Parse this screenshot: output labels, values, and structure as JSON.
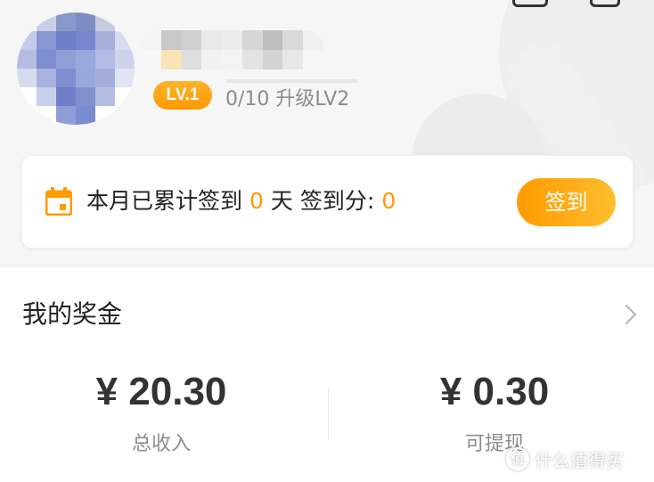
{
  "profile": {
    "level_badge": "LV.1",
    "level_progress_text": "0/10 升级LV2",
    "level_progress_fraction": 0
  },
  "signin": {
    "prefix": "本月已累计签到",
    "days_count": "0",
    "days_unit": "天",
    "score_label": "签到分:",
    "score_value": "0",
    "button_label": "签到"
  },
  "bonus": {
    "title": "我的奖金",
    "total": {
      "amount": "¥ 20.30",
      "label": "总收入"
    },
    "withdrawable": {
      "amount": "¥ 0.30",
      "label": "可提现"
    }
  },
  "watermark": {
    "logo": "值",
    "text": "什么值得买"
  },
  "colors": {
    "accent": "#ff9a00",
    "text_primary": "#222222",
    "text_secondary": "#8c8c8c",
    "header_bg": "#f6f6f6"
  },
  "icons": {
    "calendar": "calendar-icon",
    "chevron": "chevron-right-icon"
  }
}
